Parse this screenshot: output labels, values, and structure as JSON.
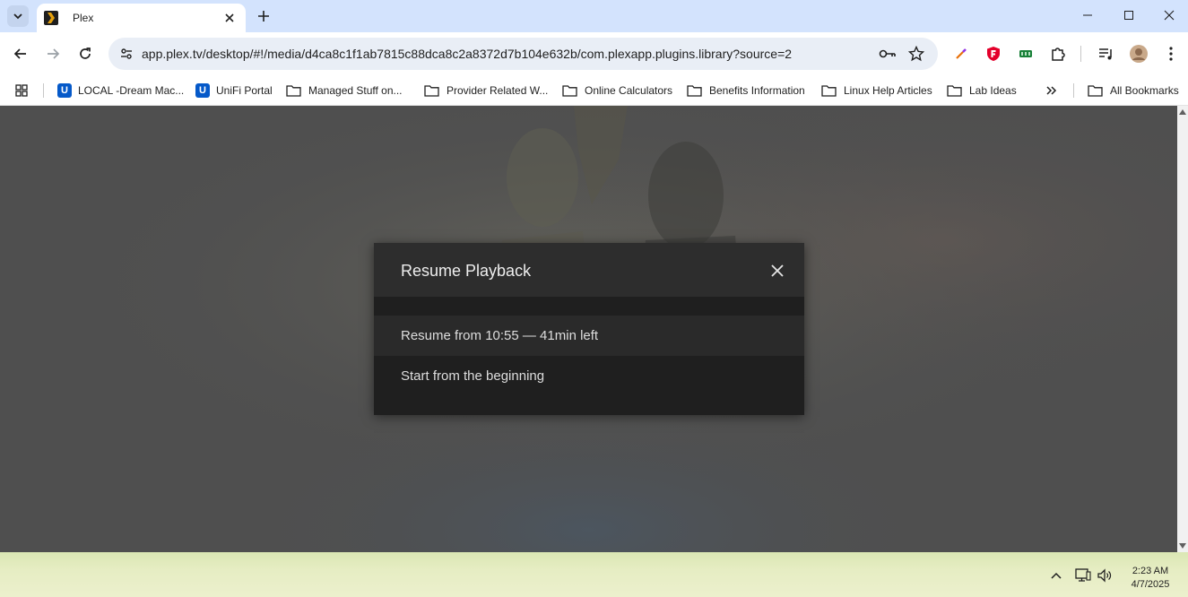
{
  "browser": {
    "tab": {
      "title": "Plex",
      "icon": "plex-icon"
    },
    "address": {
      "url": "app.plex.tv/desktop/#!/media/d4ca8c1f1ab7815c88dca8c2a8372d7b104e632b/com.plexapp.plugins.library?source=2"
    },
    "bookmarks": [
      {
        "label": "LOCAL -Dream Mac...",
        "icon": "unifi-icon"
      },
      {
        "label": "UniFi Portal",
        "icon": "unifi-icon"
      },
      {
        "label": "Managed Stuff on...",
        "icon": "folder-icon"
      },
      {
        "label": "Provider Related W...",
        "icon": "folder-icon"
      },
      {
        "label": "Online Calculators",
        "icon": "folder-icon"
      },
      {
        "label": "Benefits Information",
        "icon": "folder-icon"
      },
      {
        "label": "Linux Help Articles",
        "icon": "folder-icon"
      },
      {
        "label": "Lab Ideas",
        "icon": "folder-icon"
      }
    ],
    "all_bookmarks": "All Bookmarks",
    "unifi_glyph": "U"
  },
  "dialog": {
    "title": "Resume Playback",
    "options": [
      {
        "label": "Resume from 10:55 — 41min left"
      },
      {
        "label": "Start from the beginning"
      }
    ]
  },
  "taskbar": {
    "time": "2:23 AM",
    "date": "4/7/2025"
  },
  "colors": {
    "tab_strip": "#d3e3fd",
    "omnibox": "#e9eef6",
    "dialog_bg": "#1f1f1f",
    "dialog_header": "#2d2d2d",
    "backdrop": "#4f4f4f",
    "bookmark_accent": "#0559c9"
  }
}
